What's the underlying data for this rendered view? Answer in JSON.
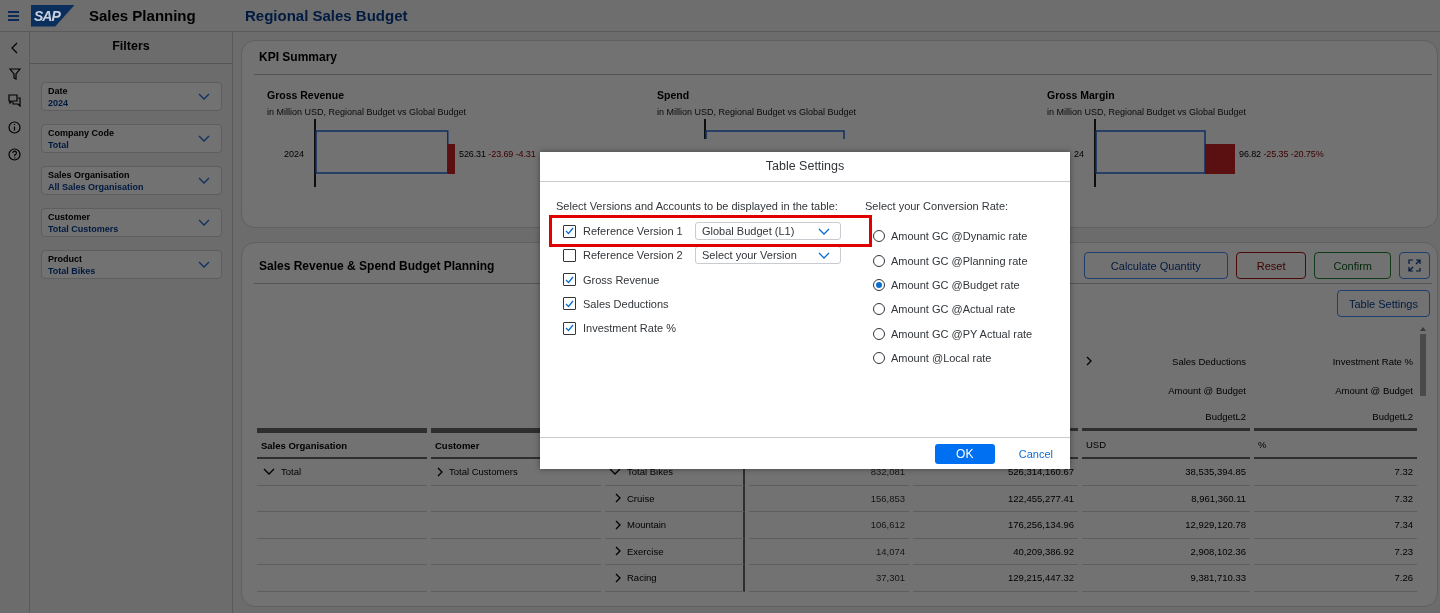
{
  "app": {
    "logo": "SAP",
    "title": "Sales Planning",
    "page_title": "Regional Sales Budget"
  },
  "filters": {
    "title": "Filters",
    "items": [
      {
        "label": "Date",
        "value": "2024"
      },
      {
        "label": "Company Code",
        "value": "Total"
      },
      {
        "label": "Sales Organisation",
        "value": "All Sales Organisation"
      },
      {
        "label": "Customer",
        "value": "Total Customers"
      },
      {
        "label": "Product",
        "value": "Total Bikes"
      }
    ]
  },
  "kpi_summary": {
    "title": "KPI Summary",
    "kpis": [
      {
        "title": "Gross Revenue",
        "subtitle": "in Million USD, Regional Budget vs Global Budget",
        "category": "2024",
        "value": "526.31",
        "delta": "-23.69",
        "delta_pct": "-4.31"
      },
      {
        "title": "Spend",
        "subtitle": "in Million USD, Regional Budget vs Global Budget"
      },
      {
        "title": "Gross Margin",
        "subtitle": "in Million USD, Regional Budget vs Global Budget",
        "category": "24",
        "value": "96.82",
        "delta": "-25.35",
        "delta_pct": "-20.75%"
      }
    ]
  },
  "planning": {
    "title": "Sales Revenue & Spend Budget Planning",
    "toolbar": [
      {
        "label": "Calculate Quantity",
        "kind": "default"
      },
      {
        "label": "Reset",
        "kind": "reject"
      },
      {
        "label": "Confirm",
        "kind": "accept"
      }
    ],
    "table_settings_button": "Table Settings",
    "table": {
      "columns": [
        {
          "label": "Sales Organisation"
        },
        {
          "label": "Customer"
        }
      ],
      "measures": [
        {
          "account": "Sales Deductions",
          "expanded": false,
          "basis": "Amount @ Budget",
          "version": "BudgetL2",
          "unit": "USD"
        },
        {
          "account": "Investment Rate %",
          "basis": "Amount @ Budget",
          "version": "BudgetL2",
          "unit": "%"
        }
      ],
      "rows": [
        {
          "sales_org": {
            "label": "Total",
            "expanded": true
          },
          "customer": {
            "label": "Total Customers",
            "expanded": false
          },
          "product": {
            "label": "Total Bikes",
            "expanded": true
          },
          "values": [
            "832,081",
            "526,314,160.67",
            "38,535,394.85",
            "7.32"
          ]
        },
        {
          "product": {
            "label": "Cruise",
            "expanded": false
          },
          "values": [
            "156,853",
            "122,455,277.41",
            "8,961,360.11",
            "7.32"
          ]
        },
        {
          "product": {
            "label": "Mountain",
            "expanded": false
          },
          "values": [
            "106,612",
            "176,256,134.96",
            "12,929,120.78",
            "7.34"
          ]
        },
        {
          "product": {
            "label": "Exercise",
            "expanded": false
          },
          "values": [
            "14,074",
            "40,209,386.92",
            "2,908,102.36",
            "7.23"
          ]
        },
        {
          "product": {
            "label": "Racing",
            "expanded": false
          },
          "values": [
            "37,301",
            "129,215,447.32",
            "9,381,710.33",
            "7.26"
          ]
        }
      ]
    }
  },
  "dialog": {
    "title": "Table Settings",
    "versions_label": "Select Versions and Accounts to be displayed in the table:",
    "options": [
      {
        "label": "Reference Version 1",
        "checked": true,
        "highlighted": true,
        "select": {
          "value": "Global Budget (L1)"
        }
      },
      {
        "label": "Reference Version 2",
        "checked": false,
        "select": {
          "placeholder": "Select your Version"
        }
      },
      {
        "label": "Gross Revenue",
        "checked": true
      },
      {
        "label": "Sales Deductions",
        "checked": true
      },
      {
        "label": "Investment Rate %",
        "checked": true
      }
    ],
    "rate_label": "Select your Conversion Rate:",
    "rates": [
      {
        "label": "Amount GC @Dynamic rate",
        "selected": false
      },
      {
        "label": "Amount GC @Planning rate",
        "selected": false
      },
      {
        "label": "Amount GC @Budget rate",
        "selected": true
      },
      {
        "label": "Amount GC @Actual rate",
        "selected": false
      },
      {
        "label": "Amount GC @PY Actual rate",
        "selected": false
      },
      {
        "label": "Amount @Local rate",
        "selected": false
      }
    ],
    "ok": "OK",
    "cancel": "Cancel"
  }
}
